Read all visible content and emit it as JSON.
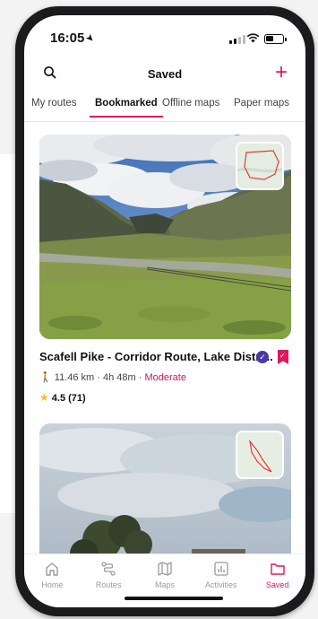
{
  "status": {
    "time": "16:05"
  },
  "header": {
    "title": "Saved"
  },
  "tabs": [
    {
      "label": "My routes"
    },
    {
      "label": "Bookmarked"
    },
    {
      "label": "Offline maps"
    },
    {
      "label": "Paper maps"
    }
  ],
  "routes": [
    {
      "title": "Scafell Pike - Corridor Route, Lake Distri...",
      "distance": "11.46 km",
      "duration": "4h 48m",
      "difficulty": "Moderate",
      "rating": "4.5 (71)"
    }
  ],
  "nav": [
    {
      "label": "Home",
      "icon": "home-icon"
    },
    {
      "label": "Routes",
      "icon": "routes-icon"
    },
    {
      "label": "Maps",
      "icon": "map-icon"
    },
    {
      "label": "Activities",
      "icon": "activities-icon"
    },
    {
      "label": "Saved",
      "icon": "folder-icon"
    }
  ],
  "colors": {
    "accent": "#e2165e",
    "verified": "#4a3aa8",
    "star": "#f5b93a"
  }
}
